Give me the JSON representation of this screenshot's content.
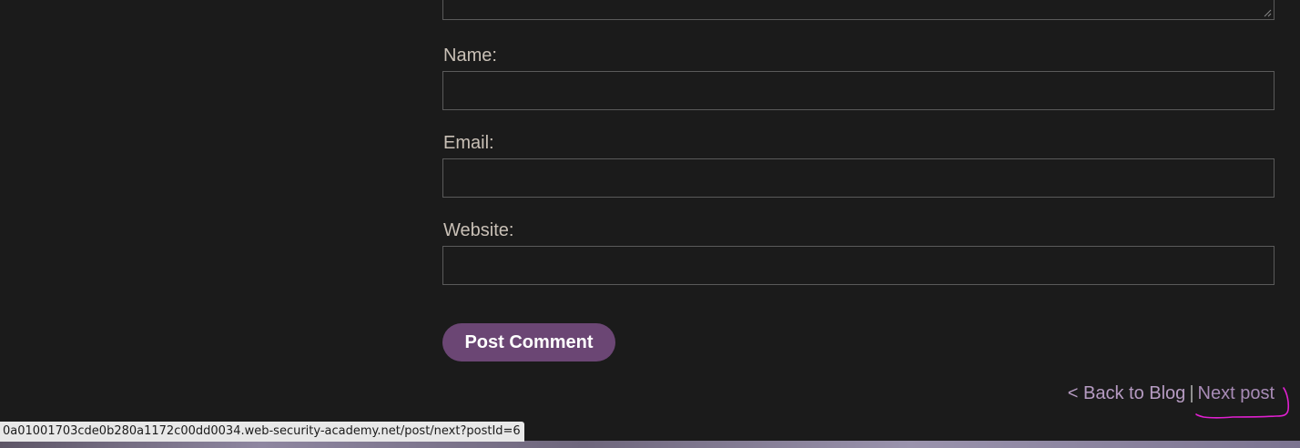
{
  "form": {
    "name_label": "Name:",
    "email_label": "Email:",
    "website_label": "Website:",
    "name_value": "",
    "email_value": "",
    "website_value": "",
    "submit_label": "Post Comment"
  },
  "navigation": {
    "back_label": "< Back to Blog",
    "separator": "|",
    "next_label": "Next post"
  },
  "status_bar": {
    "url": "0a01001703cde0b280a1172c00dd0034.web-security-academy.net/post/next?postId=6"
  },
  "colors": {
    "background": "#1b1b1b",
    "button": "#6b4674",
    "link": "#b79cc3",
    "annotation": "#e020d0"
  }
}
